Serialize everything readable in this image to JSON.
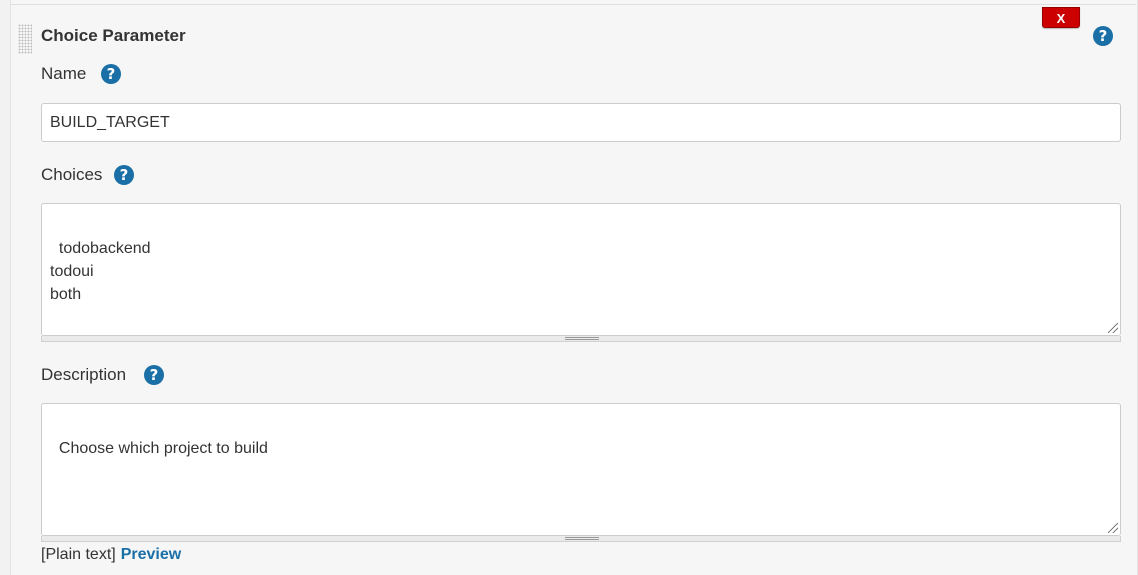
{
  "section": {
    "title": "Choice Parameter",
    "delete_label": "X",
    "help_glyph": "?"
  },
  "name_field": {
    "label": "Name",
    "value": "BUILD_TARGET"
  },
  "choices_field": {
    "label": "Choices",
    "value": "todobackend\ntodoui\nboth"
  },
  "description_field": {
    "label": "Description",
    "value": "Choose which project to build"
  },
  "footer": {
    "format_label": "[Plain text]",
    "preview_label": "Preview"
  },
  "colors": {
    "help_icon": "#1a6fa6",
    "delete_button": "#cc0000",
    "link": "#1a6fa6"
  },
  "icons": {
    "help": "help-icon",
    "drag": "drag-handle-icon",
    "resize": "resize-grip-icon"
  }
}
